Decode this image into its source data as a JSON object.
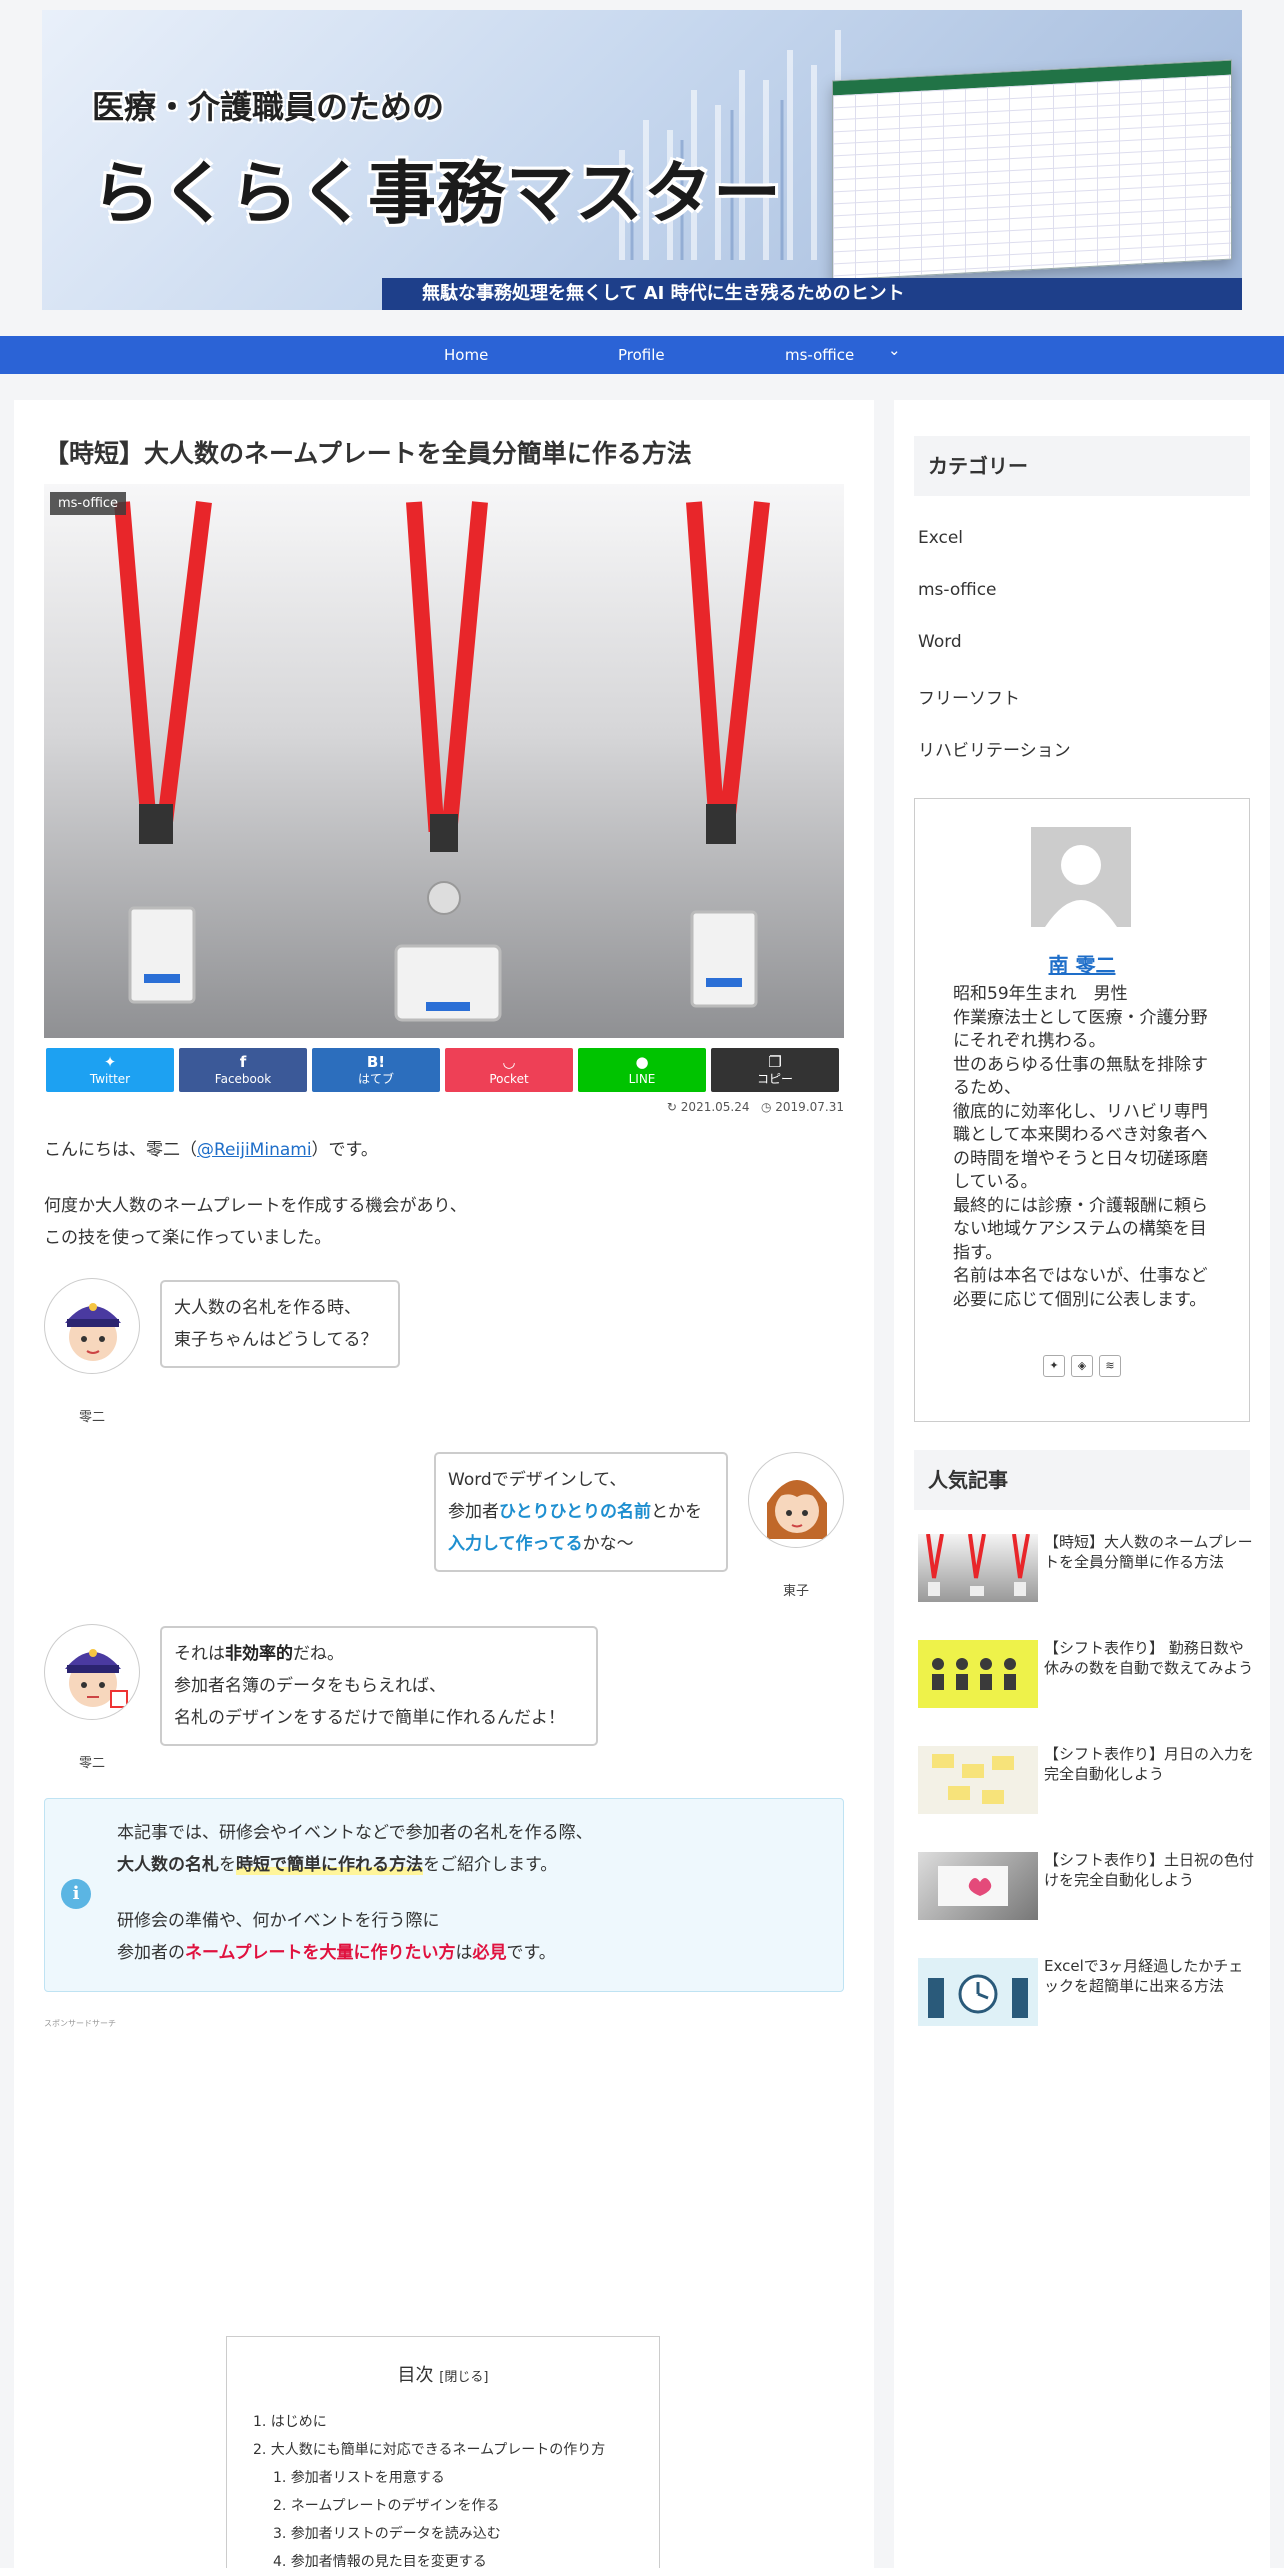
{
  "banner": {
    "subtitle": "医療・介護職員のための",
    "title": "らくらく事務マスター",
    "tagline": "無駄な事務処理を無くして AI 時代に生き残るためのヒント"
  },
  "nav": {
    "home": "Home",
    "profile": "Profile",
    "office": "ms-office",
    "chevron": "⌄"
  },
  "article": {
    "title": "【時短】大人数のネームプレートを全員分簡単に作る方法",
    "category_label": "ms-office",
    "share": {
      "twitter": "Twitter",
      "facebook": "Facebook",
      "hatebu": "はてブ",
      "pocket": "Pocket",
      "line": "LINE",
      "copy": "コピー"
    },
    "share_colors": {
      "twitter": "#1da1f2",
      "facebook": "#3b5998",
      "hatebu": "#2c6ebd",
      "pocket": "#ee4056",
      "line": "#00c300",
      "copy": "#333333"
    },
    "updated": "2021.05.24",
    "published": "2019.07.31",
    "intro_pre": "こんにちは、零二（",
    "intro_link": "@ReijiMinami",
    "intro_post": "）です。",
    "para2_l1": "何度か大人数のネームプレートを作成する機会があり、",
    "para2_l2": "この技を使って楽に作っていました。"
  },
  "chat": {
    "reiji_name": "零二",
    "higashiko_name": "東子",
    "b1_l1": "大人数の名札を作る時、",
    "b1_l2": "東子ちゃんはどうしてる？",
    "b2_l1": "Wordでデザインして、",
    "b2_l2_pre": "参加者",
    "b2_l2_hl": "ひとりひとりの名前",
    "b2_l2_post": "とかを",
    "b2_l3_hl": "入力して作ってる",
    "b2_l3_post": "かな～",
    "b3_l1_pre": "それは",
    "b3_l1_bold": "非効率的",
    "b3_l1_post": "だね。",
    "b3_l2": "参加者名簿のデータをもらえれば、",
    "b3_l3": "名札のデザインをするだけで簡単に作れるんだよ！"
  },
  "info": {
    "icon": "i",
    "l1": "本記事では、研修会やイベントなどで参加者の名札を作る際、",
    "l2_bold": "大人数の名札",
    "l2_mid": "を",
    "l2_hl": "時短で簡単に作れる方法",
    "l2_post": "をご紹介します。",
    "l3": "研修会の準備や、何かイベントを行う際に",
    "l4_pre": "参加者の",
    "l4_red": "ネームプレートを大量に作りたい方",
    "l4_mid": "は",
    "l4_red2": "必見",
    "l4_post": "です。"
  },
  "sponsor": "スポンサードサーチ",
  "toc": {
    "title": "目次",
    "toggle": "[閉じる]",
    "items": [
      "1. はじめに",
      "2. 大人数にも簡単に対応できるネームプレートの作り方",
      "1. 参加者リストを用意する",
      "2. ネームプレートのデザインを作る",
      "3. 参加者リストのデータを読み込む",
      "4. 参加者情報の見た目を変更する"
    ]
  },
  "sidebar": {
    "categories_title": "カテゴリー",
    "categories": [
      "Excel",
      "ms-office",
      "Word",
      "フリーソフト",
      "リハビリテーション"
    ],
    "profile_name": "南 零二",
    "bio": [
      "昭和59年生まれ　男性",
      "作業療法士として医療・介護分野にそれぞれ携わる。",
      "世のあらゆる仕事の無駄を排除するため、",
      "徹底的に効率化し、リハビリ専門職として本来関わるべき対象者への時間を増やそうと日々切磋琢磨している。",
      "最終的には診療・介護報酬に頼らない地域ケアシステムの構築を目指す。",
      "名前は本名ではないが、仕事など必要に応じて個別に公表します。"
    ],
    "popular_title": "人気記事",
    "popular": [
      "【時短】大人数のネームプレートを全員分簡単に作る方法",
      "【シフト表作り】 勤務日数や休みの数を自動で数えてみよう",
      "【シフト表作り】月日の入力を完全自動化しよう",
      "【シフト表作り】土日祝の色付けを完全自動化しよう",
      "Excelで3ヶ月経過したかチェックを超簡単に出来る方法"
    ]
  }
}
